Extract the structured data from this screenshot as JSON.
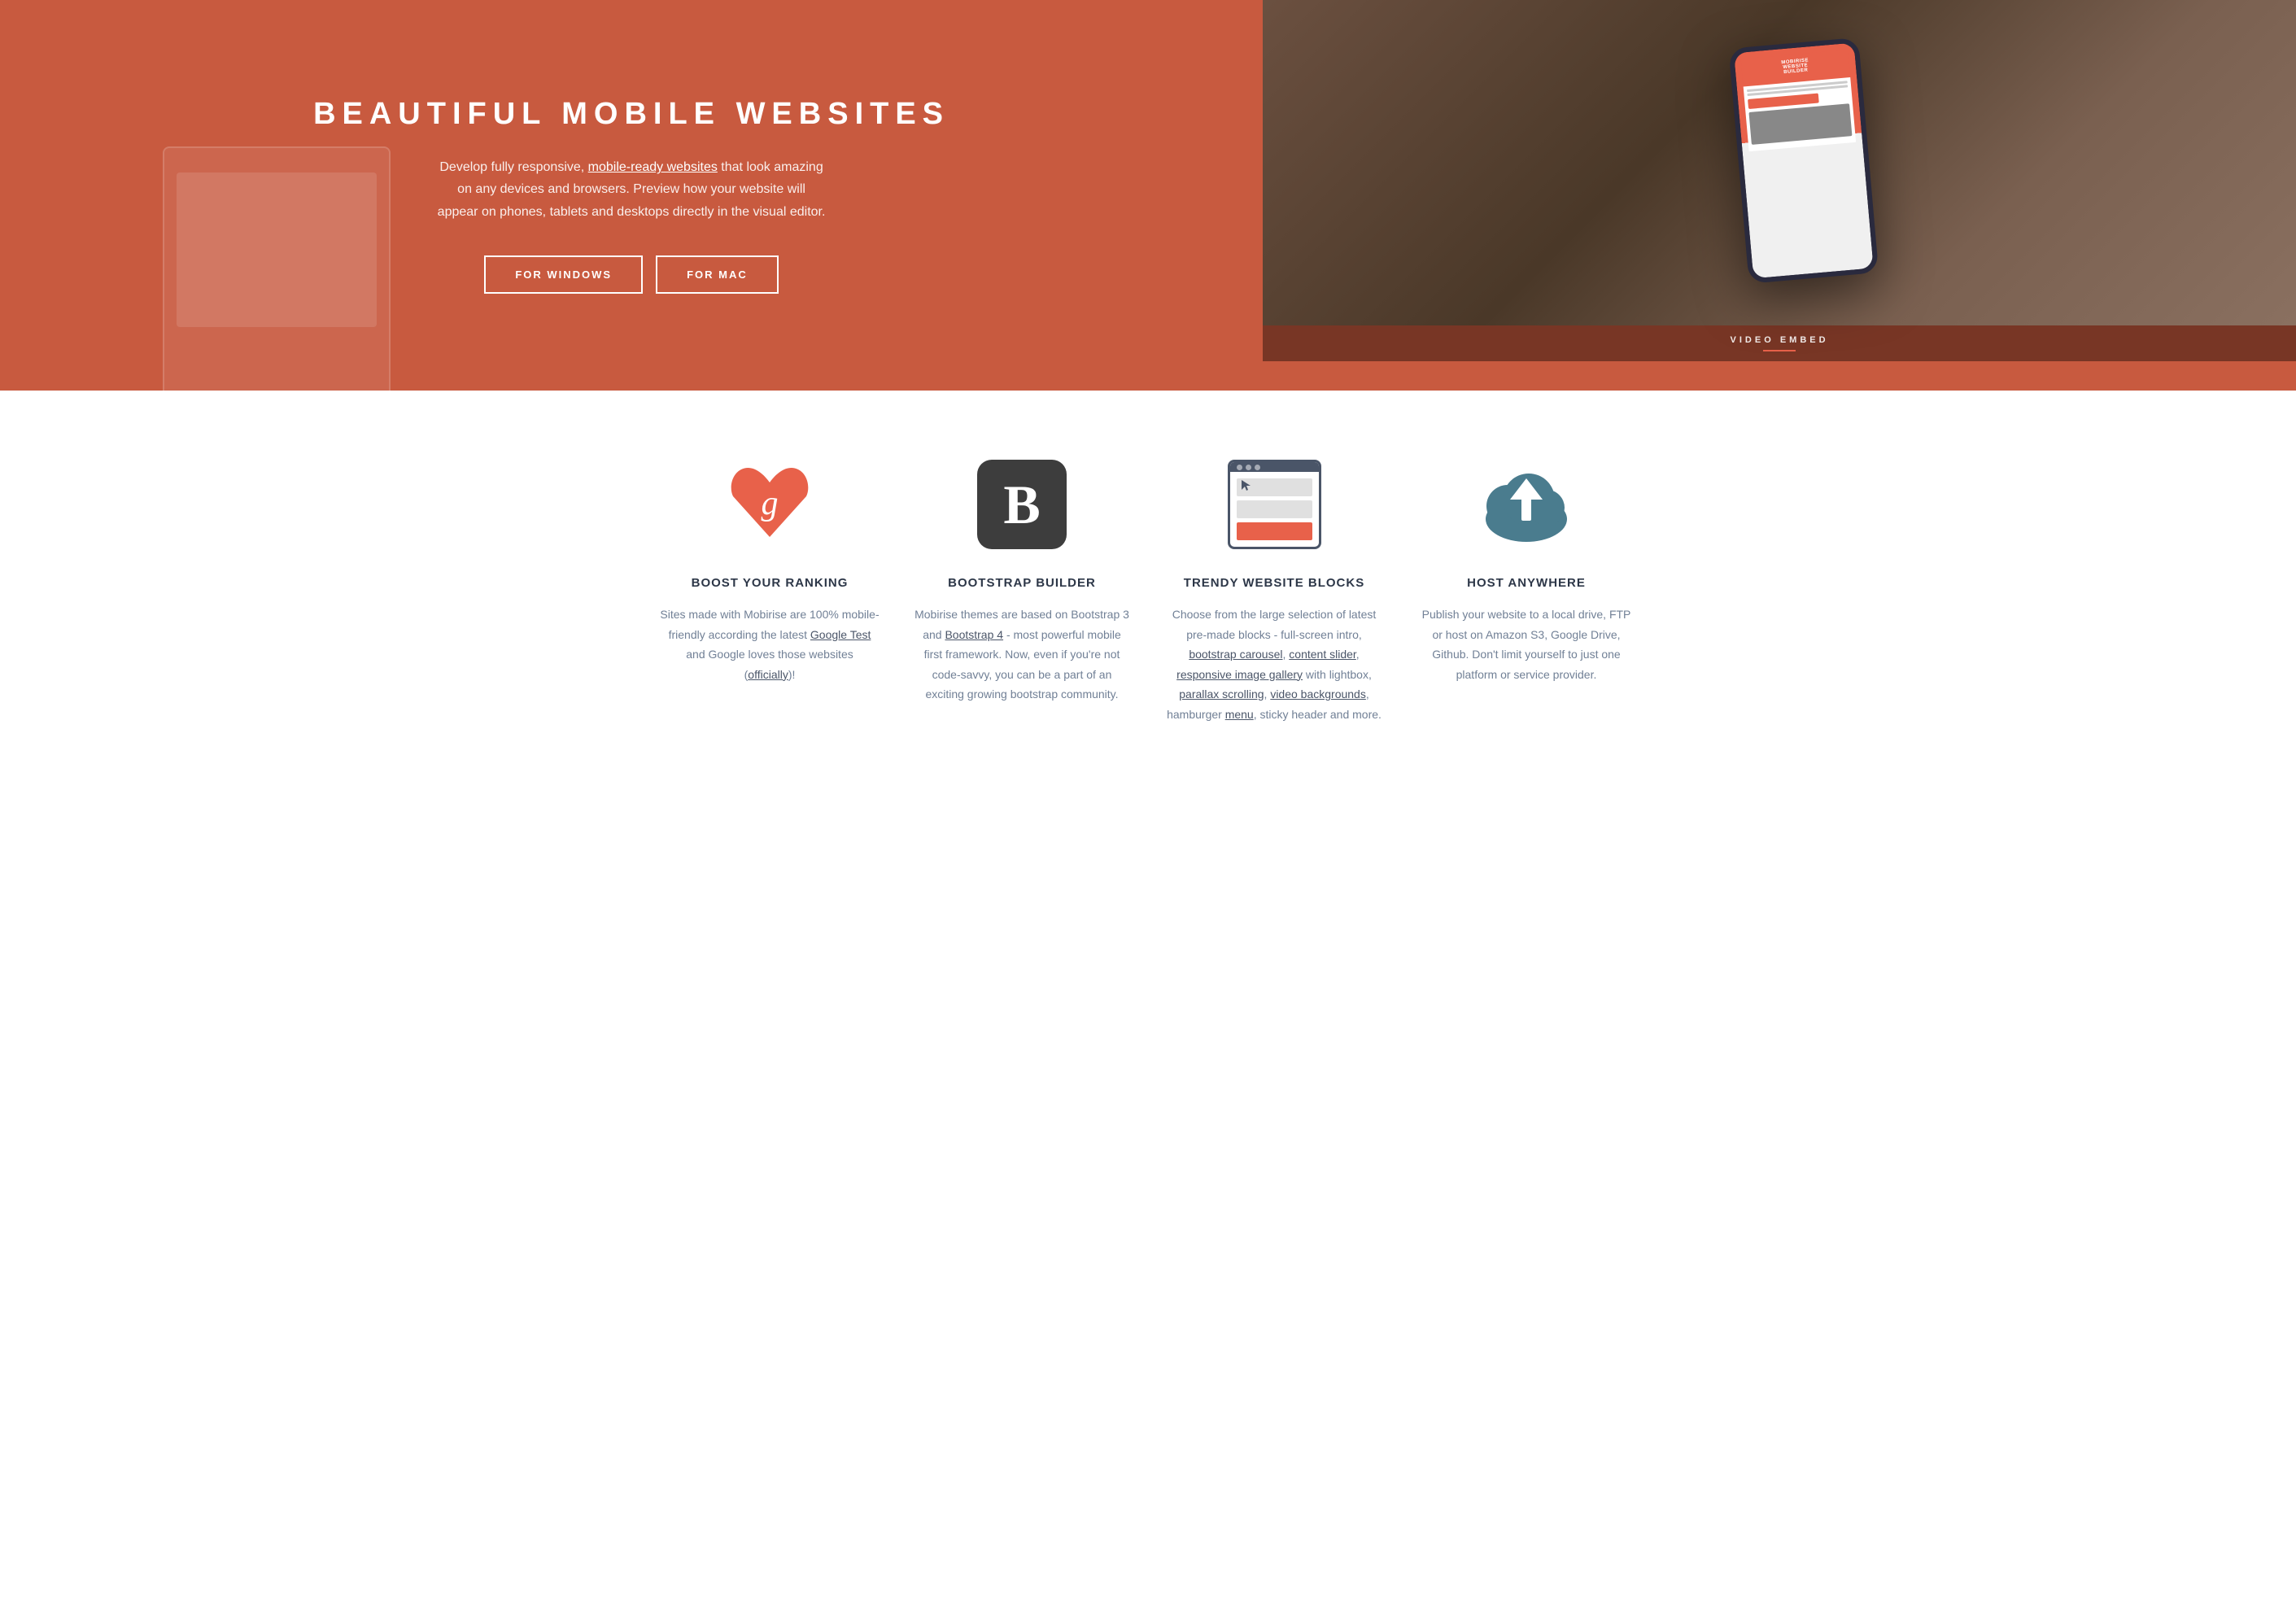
{
  "hero": {
    "title": "BEAUTIFUL MOBILE WEBSITES",
    "description_prefix": "Develop fully responsive, ",
    "description_link_text": "mobile-ready websites",
    "description_suffix": " that look amazing on any devices and browsers. Preview how your website will appear on phones, tablets and desktops directly in the visual editor.",
    "btn_windows": "FOR WINDOWS",
    "btn_mac": "FOR MAC",
    "video_label": "VIDEO EMBED",
    "phone_title_line1": "MOBIRISE",
    "phone_title_line2": "WEBSITE",
    "phone_title_line3": "BUILDER"
  },
  "features": {
    "items": [
      {
        "id": "boost",
        "icon_name": "google-heart-icon",
        "title": "BOOST YOUR RANKING",
        "description": "Sites made with Mobirise are 100% mobile-friendly according the latest ",
        "link1_text": "Google Test",
        "description_mid": " and Google loves those websites (",
        "link2_text": "officially",
        "description_end": ")!"
      },
      {
        "id": "bootstrap",
        "icon_name": "bootstrap-icon",
        "title": "BOOTSTRAP BUILDER",
        "description": "Mobirise themes are based on Bootstrap 3 and ",
        "link1_text": "Bootstrap 4",
        "description_end": " - most powerful mobile first framework. Now, even if you're not code-savvy, you can be a part of an exciting growing bootstrap community."
      },
      {
        "id": "trendy",
        "icon_name": "browser-blocks-icon",
        "title": "TRENDY WEBSITE BLOCKS",
        "description": "Choose from the large selection of latest pre-made blocks - full-screen intro, ",
        "link1_text": "bootstrap carousel",
        "description_mid1": ", ",
        "link2_text": "content slider",
        "description_mid2": ", ",
        "link3_text": "responsive image gallery",
        "description_mid3": " with lightbox, ",
        "link4_text": "parallax scrolling",
        "description_mid4": ", ",
        "link5_text": "video backgrounds",
        "description_mid5": ", hamburger ",
        "link6_text": "menu",
        "description_end": ", sticky header and more."
      },
      {
        "id": "host",
        "icon_name": "cloud-upload-icon",
        "title": "HOST ANYWHERE",
        "description": "Publish your website to a local drive, FTP or host on Amazon S3, Google Drive, Github. Don't limit yourself to just one platform or service provider."
      }
    ]
  }
}
